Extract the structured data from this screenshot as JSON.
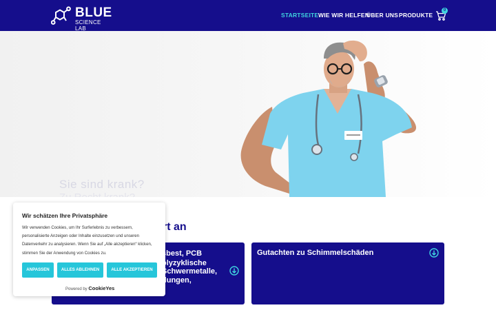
{
  "header": {
    "logo_title": "BLUE",
    "logo_subtitle": "SCIENCE LAB",
    "nav": [
      "STARTSEITE",
      "WIE WIR HELFEN",
      "ÜBER UNS",
      "PRODUKTE"
    ],
    "active_nav": "STARTSEITE",
    "cart_count": "0",
    "icons": [
      "molecule-logo-icon",
      "cart-icon"
    ]
  },
  "hero": {
    "headline": "Sie sind krank?",
    "subline": "Zu Recht krank?"
  },
  "section": {
    "title_fragment": "rt an"
  },
  "cards": [
    {
      "lines": [
        "sbest, PCB",
        "olyzyklische",
        "Schwermetalle,",
        "dungen,"
      ]
    },
    {
      "lines": [
        "Gutachten zu Schimmelschäden"
      ]
    }
  ],
  "cookie": {
    "title": "Wir schätzen Ihre Privatsphäre",
    "text": "Wir verwenden Cookies, um Ihr Surferlebnis zu verbessern, personalisierte Anzeigen oder Inhalte einzusetzen und unseren Datenverkehr zu analysieren. Wenn Sie auf „Alle akzeptieren“ klicken, stimmen Sie der Anwendung von Cookies zu.",
    "buttons": [
      "ANPASSEN",
      "ALLES ABLEHNEN",
      "ALLE AKZEPTIEREN"
    ],
    "powered_by": "Powered by",
    "brand": "CookieYes"
  },
  "colors": {
    "brand_navy": "#150e8c",
    "accent_cyan": "#3fd3df",
    "button_teal": "#26c6da"
  }
}
